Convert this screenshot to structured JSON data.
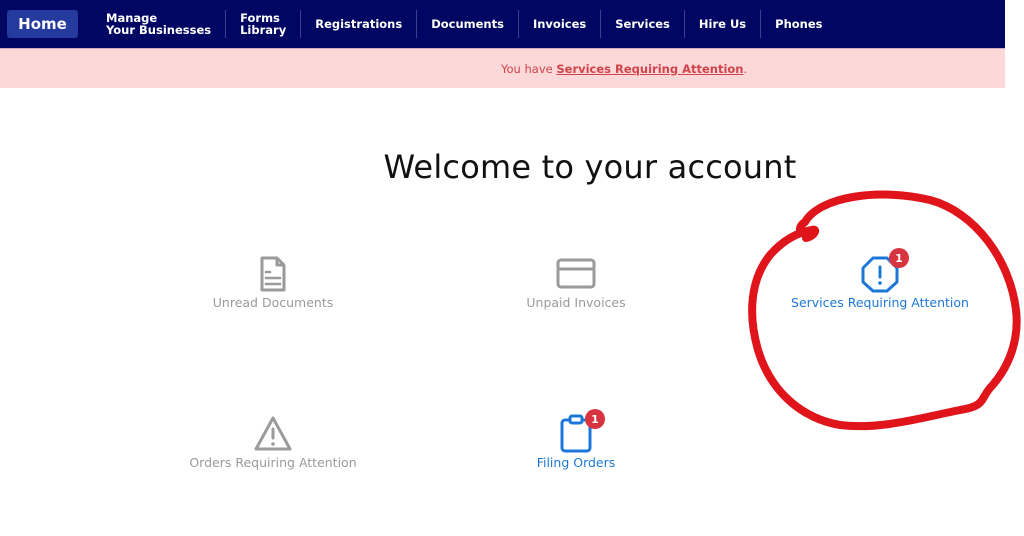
{
  "nav": {
    "home": "Home",
    "items": [
      {
        "line1": "Manage",
        "line2": "Your Businesses"
      },
      {
        "line1": "Forms",
        "line2": "Library"
      },
      {
        "label": "Registrations"
      },
      {
        "label": "Documents"
      },
      {
        "label": "Invoices"
      },
      {
        "label": "Services"
      },
      {
        "label": "Hire Us"
      },
      {
        "label": "Phones"
      }
    ]
  },
  "alert": {
    "prefix": "You have ",
    "link": "Services Requiring Attention",
    "suffix": "."
  },
  "main": {
    "title": "Welcome to your account",
    "tiles": [
      {
        "label": "Unread Documents",
        "icon": "document-icon",
        "state": "inactive"
      },
      {
        "label": "Unpaid Invoices",
        "icon": "credit-card-icon",
        "state": "inactive"
      },
      {
        "label": "Services Requiring Attention",
        "icon": "octagon-alert-icon",
        "state": "active",
        "badge": "1"
      },
      {
        "label": "Orders Requiring Attention",
        "icon": "triangle-warning-icon",
        "state": "inactive"
      },
      {
        "label": "Filing Orders",
        "icon": "clipboard-icon",
        "state": "active",
        "badge": "1"
      }
    ]
  },
  "colors": {
    "nav_bg": "#010662",
    "home_bg": "#243a9c",
    "alert_bg": "#fdd8d8",
    "alert_text": "#d0434b",
    "active": "#1c78d8",
    "inactive": "#9a9a9a",
    "badge": "#d7343f",
    "annotation": "#e0141b"
  }
}
